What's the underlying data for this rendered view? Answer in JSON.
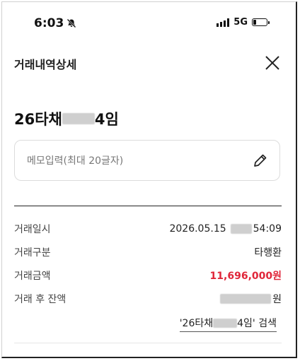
{
  "status_bar": {
    "time": "6:03",
    "network": "5G"
  },
  "header": {
    "title": "거래내역상세"
  },
  "transaction": {
    "title_prefix": "26타채",
    "title_suffix": "4임",
    "memo": {
      "placeholder": "메모입력(최대 20글자)"
    },
    "details": [
      {
        "label": "거래일시",
        "value_prefix": "2026.05.15",
        "value_suffix": "54:09"
      },
      {
        "label": "거래구분",
        "value": "타행환"
      },
      {
        "label": "거래금액",
        "value": "11,696,000원"
      },
      {
        "label": "거래 후 잔액",
        "value_suffix": "원"
      }
    ],
    "search_link": {
      "prefix": "'26타채",
      "suffix": "4임' 검색"
    }
  },
  "colors": {
    "amount": "#e0263a",
    "divider": "#222222"
  }
}
